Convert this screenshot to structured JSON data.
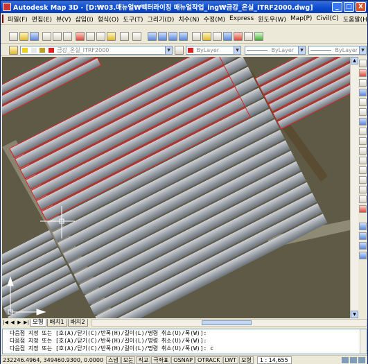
{
  "window": {
    "title": "Autodesk Map 3D - [D:₩03.매뉴얼₩벡터라이징 매뉴얼작업_ing₩금강_온실_ITRF2000.dwg]",
    "minimize_label": "_",
    "maximize_label": "□",
    "close_label": "X"
  },
  "menu": {
    "items": [
      "파일(F)",
      "편집(E)",
      "뷰(V)",
      "삽입(I)",
      "형식(O)",
      "도구(T)",
      "그리기(D)",
      "치수(N)",
      "수정(M)",
      "Express",
      "윈도우(W)",
      "Map(P)",
      "Civil(C)",
      "도움말(H)"
    ],
    "doc_controls": [
      "_",
      "□",
      "x"
    ]
  },
  "toolbar2": {
    "layer_value": "금강_온실_ITRF2000",
    "color_value": "ByLayer",
    "linetype_value": "ByLayer",
    "lineweight_value": "ByLayer"
  },
  "tabs": {
    "items": [
      "모형",
      "배치1",
      "배치2"
    ],
    "nav": [
      "|◀",
      "◀",
      "▶",
      "▶|"
    ]
  },
  "command": {
    "lines": [
      "다음점 지정 또는 [호(A)/닫기(C)/반폭(H)/길이(L)/명령 취소(U)/폭(W)]:",
      "다음점 지정 또는 [호(A)/닫기(C)/반폭(H)/길이(L)/명령 취소(U)/폭(W)]:",
      "다음점 지정 또는 [호(A)/닫기(C)/반폭(H)/길이(L)/명령 취소(U)/폭(W)]: c"
    ]
  },
  "status": {
    "coordinates": "232246.4964, 349460.9300, 0.0000",
    "toggles": [
      "스냅",
      "모눈",
      "직교",
      "극좌표",
      "OSNAP",
      "OTRACK",
      "LWT",
      "모형"
    ],
    "scale": "1 : 14,655"
  },
  "colors": {
    "title_blue": "#0a4bd0",
    "digitized_outline": "#e02020",
    "crosshair": "#ffffff"
  }
}
